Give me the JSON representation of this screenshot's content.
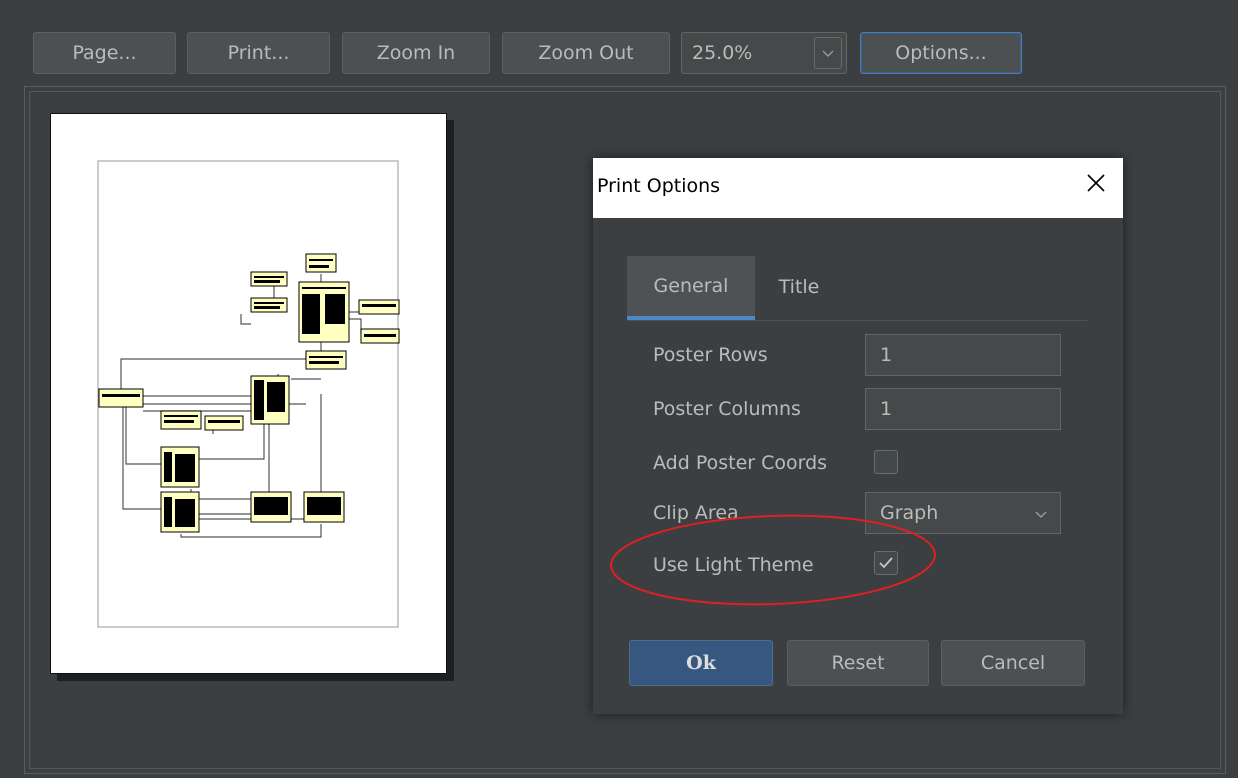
{
  "toolbar": {
    "page_label": "Page...",
    "print_label": "Print...",
    "zoom_in_label": "Zoom In",
    "zoom_out_label": "Zoom Out",
    "zoom_value": "25.0%",
    "options_label": "Options..."
  },
  "dialog": {
    "title": "Print Options",
    "tabs": [
      {
        "label": "General",
        "selected": true
      },
      {
        "label": "Title",
        "selected": false
      }
    ],
    "fields": {
      "poster_rows_label": "Poster Rows",
      "poster_rows_value": "1",
      "poster_columns_label": "Poster Columns",
      "poster_columns_value": "1",
      "add_poster_coords_label": "Add Poster Coords",
      "add_poster_coords_checked": false,
      "clip_area_label": "Clip Area",
      "clip_area_value": "Graph",
      "use_light_theme_label": "Use Light Theme",
      "use_light_theme_checked": true
    },
    "buttons": {
      "ok_label": "Ok",
      "reset_label": "Reset",
      "cancel_label": "Cancel"
    }
  },
  "colors": {
    "background": "#3c3f41",
    "accent": "#4a88c7",
    "annotation": "#e02020",
    "node_fill": "#ffffc0"
  }
}
